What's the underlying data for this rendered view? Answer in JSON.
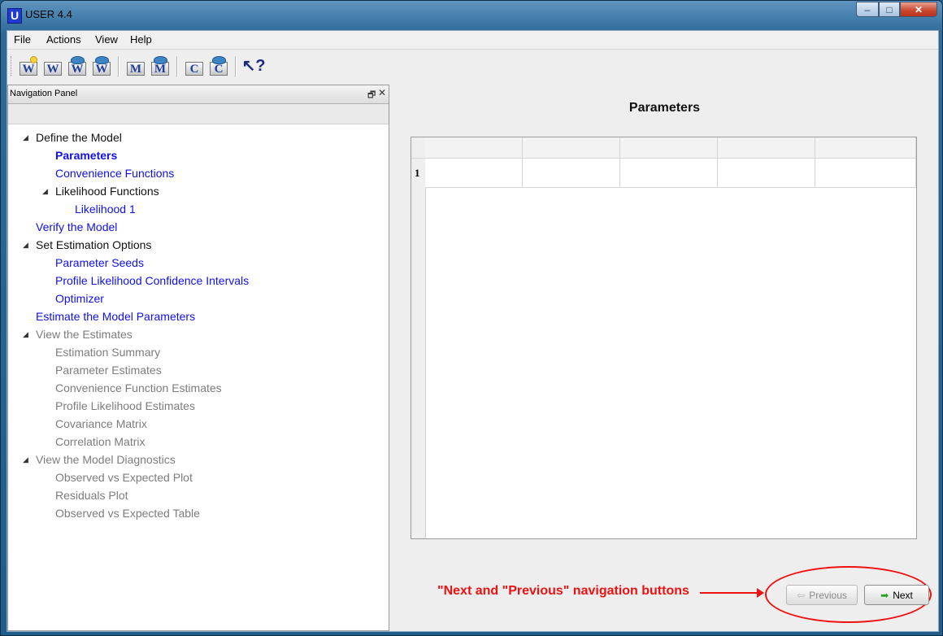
{
  "window": {
    "title": "USER 4.4",
    "app_icon_letter": "U"
  },
  "window_controls": {
    "minimize": "–",
    "maximize": "□",
    "close": "✕"
  },
  "menu": [
    "File",
    "Actions",
    "View",
    "Help"
  ],
  "toolbar": {
    "buttons": [
      {
        "letter": "W",
        "icon": "new-wizard-icon"
      },
      {
        "letter": "W",
        "icon": "wizard-icon"
      },
      {
        "letter": "W",
        "icon": "open-wizard-icon"
      },
      {
        "letter": "W",
        "icon": "save-wizard-icon"
      },
      {
        "letter": "M",
        "icon": "model-icon"
      },
      {
        "letter": "M",
        "icon": "open-model-icon"
      },
      {
        "letter": "C",
        "icon": "code-icon"
      },
      {
        "letter": "C",
        "icon": "open-code-icon"
      }
    ],
    "help_glyph": "↖?"
  },
  "nav_panel": {
    "title": "Navigation Panel",
    "float_glyph": "🗗",
    "close_glyph": "✕",
    "tree": [
      {
        "label": "Define the Model",
        "state": "black",
        "expand": "◢"
      },
      {
        "label": "Parameters",
        "state": "blue",
        "bold": true
      },
      {
        "label": "Convenience Functions",
        "state": "blue"
      },
      {
        "label": "Likelihood Functions",
        "state": "black",
        "expand": "◢"
      },
      {
        "label": "Likelihood 1",
        "state": "blue"
      },
      {
        "label": "Verify the Model",
        "state": "blue"
      },
      {
        "label": "Set Estimation Options",
        "state": "black",
        "expand": "◢"
      },
      {
        "label": "Parameter Seeds",
        "state": "blue"
      },
      {
        "label": "Profile Likelihood Confidence Intervals",
        "state": "blue"
      },
      {
        "label": "Optimizer",
        "state": "blue"
      },
      {
        "label": "Estimate the Model Parameters",
        "state": "blue"
      },
      {
        "label": "View the Estimates",
        "state": "gray",
        "expand": "◢"
      },
      {
        "label": "Estimation Summary",
        "state": "gray"
      },
      {
        "label": "Parameter Estimates",
        "state": "gray"
      },
      {
        "label": "Convenience Function Estimates",
        "state": "gray"
      },
      {
        "label": "Profile Likelihood Estimates",
        "state": "gray"
      },
      {
        "label": "Covariance Matrix",
        "state": "gray"
      },
      {
        "label": "Correlation Matrix",
        "state": "gray"
      },
      {
        "label": "View the Model Diagnostics",
        "state": "gray",
        "expand": "◢"
      },
      {
        "label": "Observed vs Expected Plot",
        "state": "gray"
      },
      {
        "label": "Residuals Plot",
        "state": "gray"
      },
      {
        "label": "Observed vs Expected Table",
        "state": "gray"
      }
    ]
  },
  "main": {
    "title": "Parameters",
    "table": {
      "row_labels": [
        "1"
      ],
      "column_count": 5
    },
    "annotation": "\"Next and \"Previous\" navigation buttons",
    "previous_button": "Previous",
    "next_button": "Next",
    "previous_icon": "⇦",
    "next_icon": "➡"
  },
  "colors": {
    "link_blue": "#1010ee",
    "disabled_gray": "#7c7c7c",
    "annotation_red": "#ef1010"
  }
}
